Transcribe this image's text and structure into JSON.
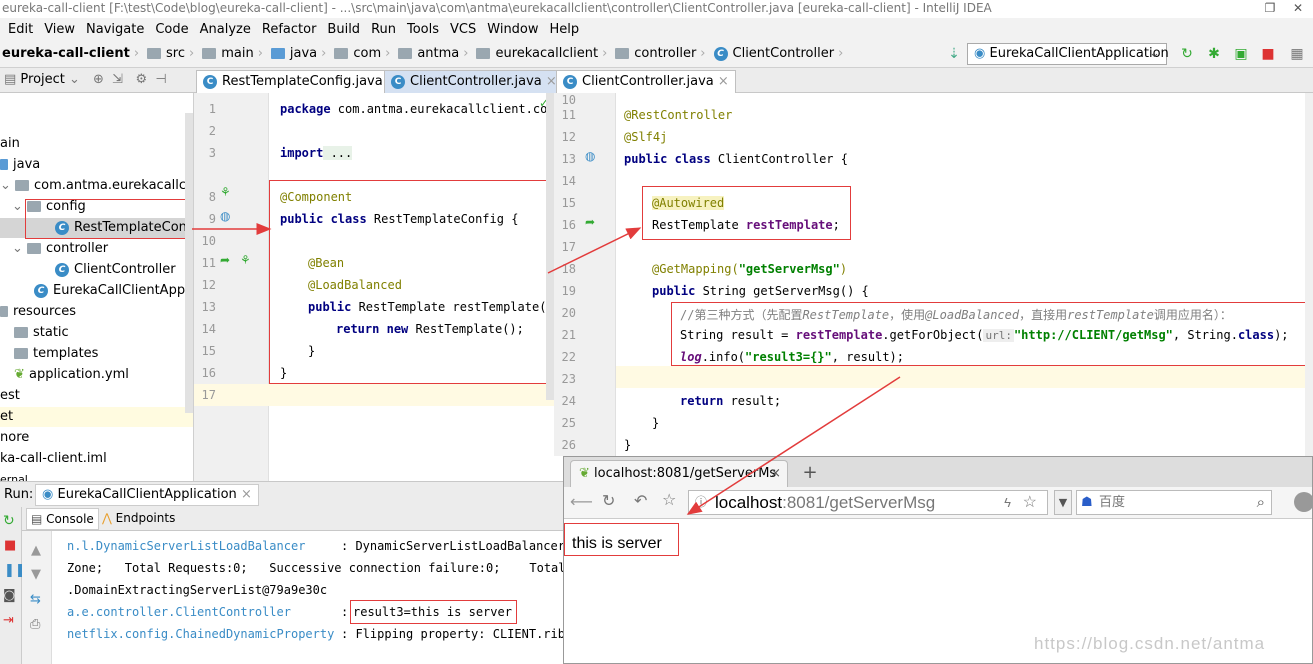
{
  "window": {
    "title": "eureka-call-client [F:\\test\\Code\\blog\\eureka-call-client] - ...\\src\\main\\java\\com\\antma\\eurekacallclient\\controller\\ClientController.java [eureka-call-client] - IntelliJ IDEA"
  },
  "menu": [
    "Edit",
    "View",
    "Navigate",
    "Code",
    "Analyze",
    "Refactor",
    "Build",
    "Run",
    "Tools",
    "VCS",
    "Window",
    "Help"
  ],
  "breadcrumb": [
    "eureka-call-client",
    "src",
    "main",
    "java",
    "com",
    "antma",
    "eurekacallclient",
    "controller",
    "ClientController"
  ],
  "run_config": "EurekaCallClientApplication",
  "project_panel": {
    "label": "Project",
    "tree": [
      "ain",
      "java",
      "com.antma.eurekacallclient",
      "config",
      "RestTemplateConfig",
      "controller",
      "ClientController",
      "EurekaCallClientApplicati",
      "resources",
      "static",
      "templates",
      "application.yml",
      "est",
      "et",
      "nore",
      "ka-call-client.iml",
      "ernal"
    ]
  },
  "tabs_left": [
    "RestTemplateConfig.java",
    "ClientController.java"
  ],
  "tab_right": "ClientController.java",
  "editor_left": {
    "line_numbers": [
      "1",
      "2",
      "3",
      "8",
      "9",
      "10",
      "11",
      "12",
      "13",
      "14",
      "15",
      "16",
      "17"
    ],
    "l1_kw": "package",
    "l1_rest": " com.antma.eurekacallclient.con",
    "l3_kw": "import",
    "l3_rest": " ...",
    "l8": "@Component",
    "l9_kw": "public class",
    "l9_rest": " RestTemplateConfig {",
    "l11": "@Bean",
    "l12": "@LoadBalanced",
    "l13_kw": "public",
    "l13_rest": " RestTemplate restTemplate()",
    "l14_kw1": "return",
    "l14_kw2": "new",
    "l14_rest": " RestTemplate();",
    "l15": "}",
    "l16": "}"
  },
  "editor_right": {
    "line_numbers": [
      "10",
      "11",
      "12",
      "13",
      "14",
      "15",
      "16",
      "17",
      "18",
      "19",
      "20",
      "21",
      "22",
      "23",
      "24",
      "25",
      "26"
    ],
    "l11": "@RestController",
    "l12": "@Slf4j",
    "l13_kw": "public class",
    "l13_rest": " ClientController {",
    "l15": "@Autowired",
    "l16_type": "RestTemplate ",
    "l16_field": "restTemplate",
    "l16_end": ";",
    "l18_ann": "@GetMapping(",
    "l18_str": "\"getServerMsg\"",
    "l18_end": ")",
    "l19_kw": "public",
    "l19_rest": " String getServerMsg() {",
    "l20_a": "//第三种方式（先配置",
    "l20_b": "RestTemplate",
    "l20_c": "，使用",
    "l20_d": "@LoadBalanced",
    "l20_e": "，直接用",
    "l20_f": "restTemplate",
    "l20_g": "调用应用名）：",
    "l21_a": "String result = ",
    "l21_b": "restTemplate",
    "l21_c": ".getForObject(",
    "l21_hint": "url:",
    "l21_str": "\"http://CLIENT/getMsg\"",
    "l21_d": ", String.",
    "l21_kw": "class",
    "l21_e": ");",
    "l22_a": "log",
    "l22_b": ".info(",
    "l22_str": "\"result3={}\"",
    "l22_c": ", result);",
    "l24_kw": "return",
    "l24_rest": " result;",
    "l25": "}",
    "l26": "}"
  },
  "run_panel": {
    "label": "Run:",
    "config": "EurekaCallClientApplication",
    "tabs": [
      "Console",
      "Endpoints"
    ],
    "lines": [
      {
        "logger": "n.l.DynamicServerListLoadBalancer",
        "msg": ": DynamicServerListLoadBalancer"
      },
      {
        "logger": "Zone;   Total Requests:0;   Successive connection failure:0;    Total b",
        "msg": ""
      },
      {
        "logger": ".DomainExtractingServerList@79a9e30c",
        "msg": ""
      },
      {
        "logger": "a.e.controller.ClientController",
        "msg": "result3=this is server"
      },
      {
        "logger": "netflix.config.ChainedDynamicProperty",
        "msg": ": Flipping property: CLIENT.ribb"
      }
    ]
  },
  "browser": {
    "tab_title": "localhost:8081/getServerMs",
    "url_host": "localhost",
    "url_rest": ":8081/getServerMsg",
    "search_placeholder": "百度",
    "body_text": "this is server"
  },
  "watermark": "https://blog.csdn.net/antma"
}
